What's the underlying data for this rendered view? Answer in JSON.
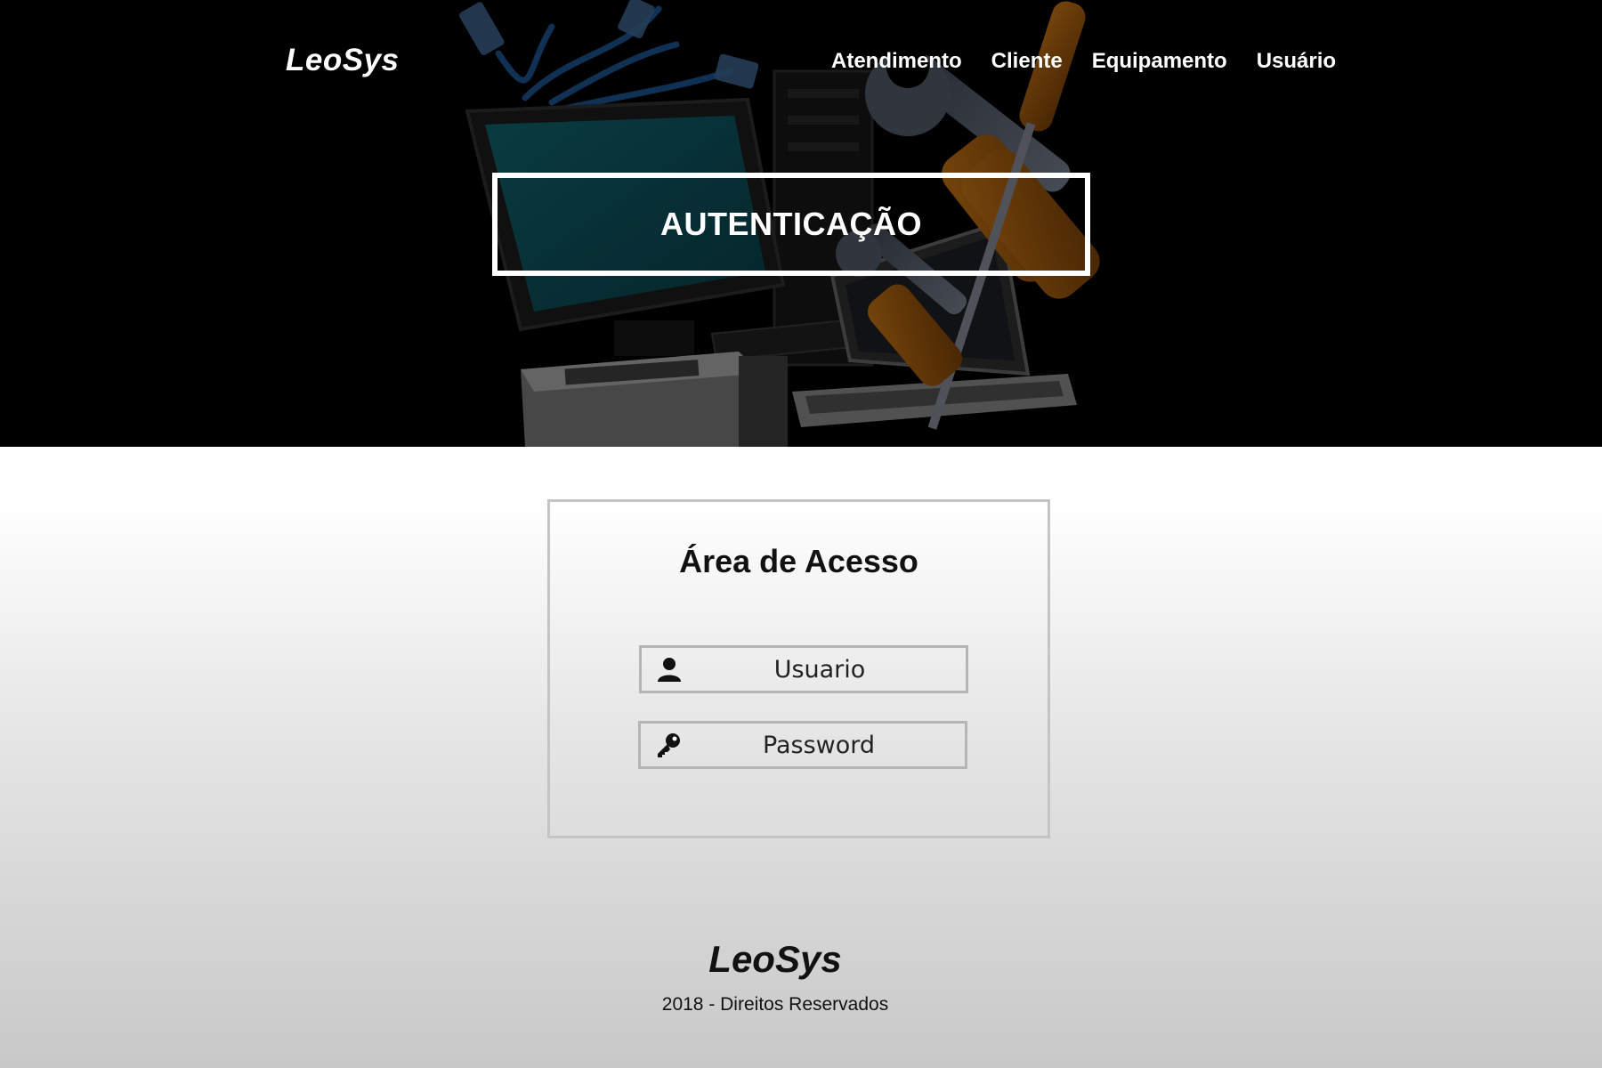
{
  "header": {
    "brand": "LeoSys",
    "nav": [
      {
        "label": "Atendimento"
      },
      {
        "label": "Cliente"
      },
      {
        "label": "Equipamento"
      },
      {
        "label": "Usuário"
      }
    ]
  },
  "hero": {
    "title": "AUTENTICAÇÃO"
  },
  "login": {
    "title": "Área de Acesso",
    "username": {
      "placeholder": "Usuario",
      "value": "",
      "icon": "user-icon"
    },
    "password": {
      "placeholder": "Password",
      "value": "",
      "icon": "key-icon"
    }
  },
  "footer": {
    "brand": "LeoSys",
    "copyright": "2018 - Direitos Reservados"
  },
  "colors": {
    "hero_background": "#000000",
    "text_on_dark": "#ffffff",
    "panel_border": "#c4c4c4",
    "field_border": "#b5b5b5"
  }
}
